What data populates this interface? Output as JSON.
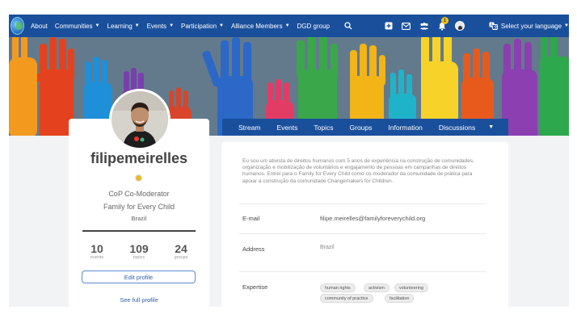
{
  "nav": {
    "items": [
      {
        "label": "About",
        "has_caret": false
      },
      {
        "label": "Communities",
        "has_caret": true
      },
      {
        "label": "Learning",
        "has_caret": true
      },
      {
        "label": "Events",
        "has_caret": true
      },
      {
        "label": "Participation",
        "has_caret": true
      },
      {
        "label": "Alliance Members",
        "has_caret": true
      },
      {
        "label": "DGD group",
        "has_caret": false
      }
    ],
    "notification_count": "1",
    "language_label": "Select your language"
  },
  "icons": {
    "logo": "globe-logo",
    "search": "search-icon",
    "add": "plus-square-icon",
    "mail": "mail-icon",
    "groups": "people-icon",
    "notifications": "bell-icon",
    "language": "translate-icon"
  },
  "tabs": [
    "Stream",
    "Events",
    "Topics",
    "Groups",
    "Information",
    "Discussions"
  ],
  "profile": {
    "username": "filipemeirelles",
    "role": "CoP Co-Moderator",
    "organization": "Family for Every Child",
    "country": "Brazil",
    "stats": [
      {
        "value": "10",
        "label": "events"
      },
      {
        "value": "109",
        "label": "topics"
      },
      {
        "value": "24",
        "label": "groups"
      }
    ],
    "edit_label": "Edit profile",
    "full_profile_label": "See full profile"
  },
  "info": {
    "bio": "Eu sou um ativista de direitos humanos com 5 anos de experiência na construção de comunidades, organização e mobilização de voluntários e engajamento de pessoas em campanhas de direitos humanos. Entrei para o Family for Every Child como co-moderador da comunidade de prática para apoiar a construção da comunidade Changemakers for Children.",
    "email_label": "E-mail",
    "email_value": "filipe.meirelles@familyforeverychild.org",
    "address_label": "Address",
    "address_value": "Brazil",
    "expertise_label": "Expertise",
    "expertise_tags": [
      "human rights",
      "activism",
      "volunteering",
      "community of practice",
      "facilitation"
    ]
  },
  "colors": {
    "nav_bg": "#1a4f9c",
    "page_bg": "#f2f3f5",
    "link": "#2d5fa8",
    "badge": "#f3c21a"
  }
}
